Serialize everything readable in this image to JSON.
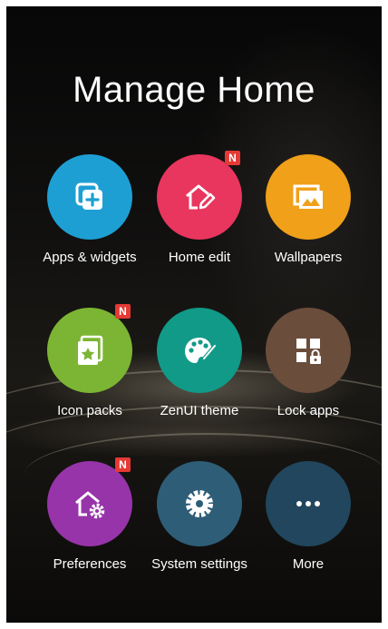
{
  "title": "Manage Home",
  "badge_text": "N",
  "items": [
    {
      "label": "Apps & widgets",
      "icon": "apps-widgets-icon",
      "color": "#1e9fd4",
      "badge": false
    },
    {
      "label": "Home edit",
      "icon": "home-edit-icon",
      "color": "#e8365e",
      "badge": true
    },
    {
      "label": "Wallpapers",
      "icon": "wallpaper-icon",
      "color": "#f0a019",
      "badge": false
    },
    {
      "label": "Icon packs",
      "icon": "icon-packs-icon",
      "color": "#7cb534",
      "badge": true
    },
    {
      "label": "ZenUI theme",
      "icon": "palette-icon",
      "color": "#119a87",
      "badge": false
    },
    {
      "label": "Lock apps",
      "icon": "lock-apps-icon",
      "color": "#6b4d3c",
      "badge": false
    },
    {
      "label": "Preferences",
      "icon": "home-settings-icon",
      "color": "#9734a9",
      "badge": true
    },
    {
      "label": "System settings",
      "icon": "gear-icon",
      "color": "#2e5d78",
      "badge": false
    },
    {
      "label": "More",
      "icon": "more-icon",
      "color": "#21465d",
      "badge": false
    }
  ]
}
